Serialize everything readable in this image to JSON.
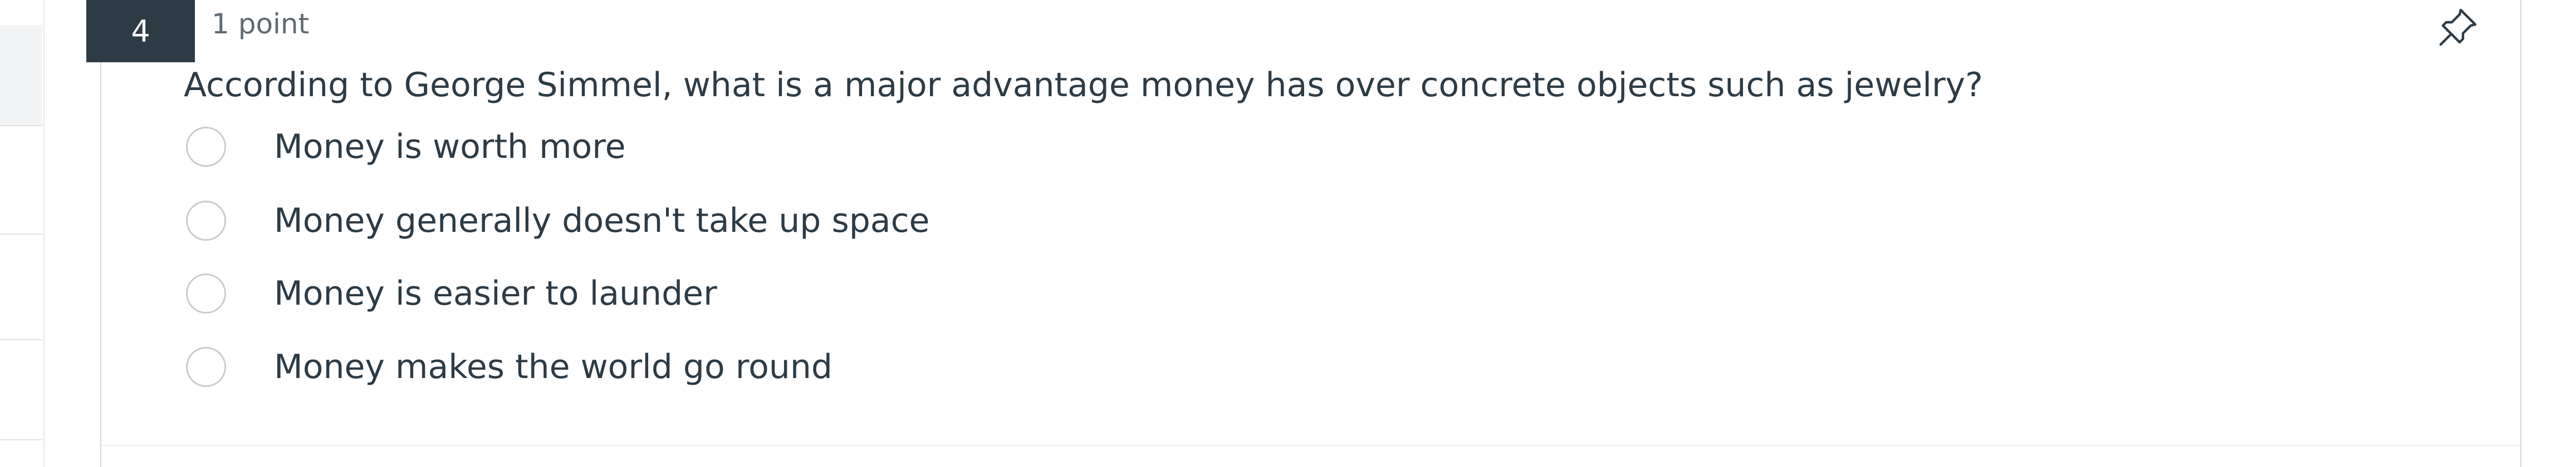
{
  "question": {
    "number": "4",
    "points": "1 point",
    "text": "According to George Simmel, what is a major advantage money has over concrete objects such as jewelry?",
    "answers": [
      {
        "label": "Money is worth more",
        "selected": false
      },
      {
        "label": "Money generally doesn't take up space",
        "selected": false
      },
      {
        "label": "Money is easier to launder",
        "selected": false
      },
      {
        "label": "Money makes the world go round",
        "selected": false
      }
    ]
  },
  "icons": {
    "pin": "pin-icon"
  },
  "colors": {
    "number_badge": "#2d3b45",
    "text": "#2d3b45",
    "muted_text": "#5f6a72",
    "radio_border": "#c7cdd1"
  }
}
